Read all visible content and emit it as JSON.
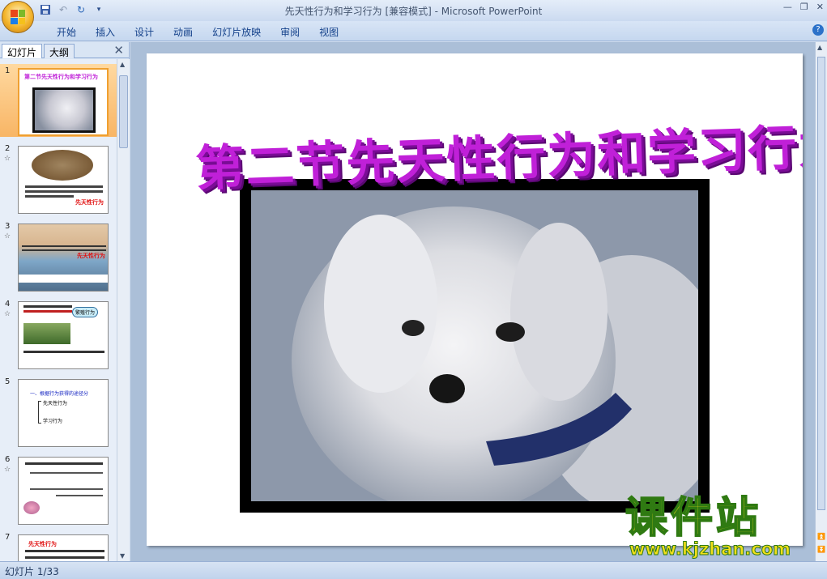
{
  "window": {
    "title": "先天性行为和学习行为 [兼容模式] - Microsoft PowerPoint"
  },
  "ribbon": {
    "tabs": [
      "开始",
      "插入",
      "设计",
      "动画",
      "幻灯片放映",
      "审阅",
      "视图"
    ]
  },
  "panel": {
    "tab_slides": "幻灯片",
    "tab_outline": "大纲"
  },
  "thumbnails": [
    {
      "number": "1",
      "title": "第二节先天性行为和学习行为"
    },
    {
      "number": "2",
      "star": "☆",
      "text": "先天性行为"
    },
    {
      "number": "3",
      "star": "☆",
      "text": "先天性行为"
    },
    {
      "number": "4",
      "star": "☆",
      "text": "繁殖行为"
    },
    {
      "number": "5",
      "heading": "一、根据行为获得的途径分",
      "item1": "先天性行为",
      "item2": "学习行为"
    },
    {
      "number": "6",
      "star": "☆"
    },
    {
      "number": "7",
      "heading": "先天性行为"
    }
  ],
  "slide": {
    "title": "第二节先天性行为和学习行为"
  },
  "status": {
    "slide_counter": "幻灯片 1/33"
  },
  "watermark": {
    "brand": "课件站",
    "url": "www.kjzhan.com"
  },
  "colors": {
    "title_purple": "#c020d8",
    "selection_orange": "#f8b565",
    "watermark_yellow": "#f3df19"
  }
}
